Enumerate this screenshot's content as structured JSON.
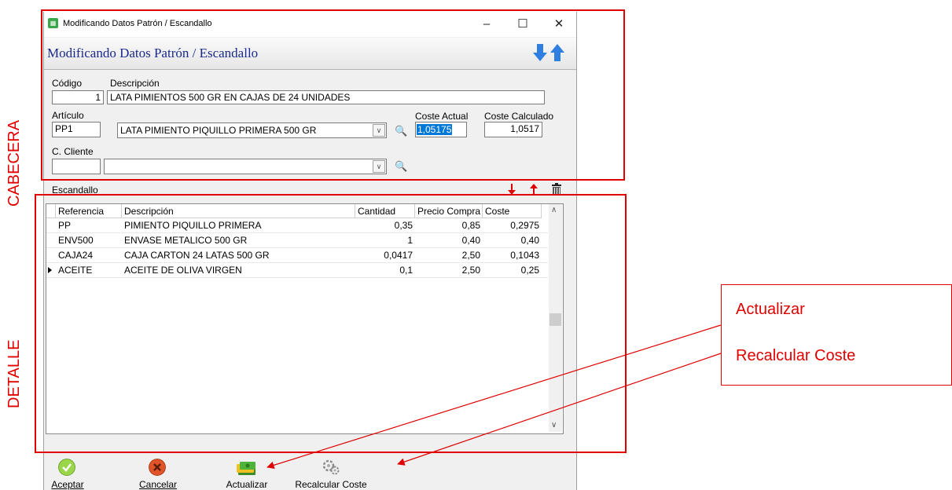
{
  "window": {
    "title": "Modificando Datos Patrón / Escandallo",
    "heading": "Modificando Datos Patrón / Escandallo"
  },
  "form": {
    "codigo_label": "Código",
    "codigo_value": "1",
    "descripcion_label": "Descripción",
    "descripcion_value": "LATA PIMIENTOS 500 GR EN CAJAS DE 24 UNIDADES",
    "articulo_label": "Artículo",
    "articulo_code": "PP1",
    "articulo_desc": "LATA PIMIENTO PIQUILLO PRIMERA 500 GR",
    "coste_actual_label": "Coste Actual",
    "coste_actual_value": "1,05175",
    "coste_calculado_label": "Coste Calculado",
    "coste_calculado_value": "1,0517",
    "cliente_label": "C. Cliente",
    "cliente_code": "",
    "cliente_desc": ""
  },
  "grid": {
    "section_label": "Escandallo",
    "columns": [
      "Referencia",
      "Descripción",
      "Cantidad",
      "Precio Compra",
      "Coste"
    ],
    "rows": [
      {
        "ref": "PP",
        "desc": "PIMIENTO PIQUILLO PRIMERA",
        "cantidad": "0,35",
        "precio": "0,85",
        "coste": "0,2975"
      },
      {
        "ref": "ENV500",
        "desc": "ENVASE METALICO 500 GR",
        "cantidad": "1",
        "precio": "0,40",
        "coste": "0,40"
      },
      {
        "ref": "CAJA24",
        "desc": "CAJA CARTON 24 LATAS 500 GR",
        "cantidad": "0,0417",
        "precio": "2,50",
        "coste": "0,1043"
      },
      {
        "ref": "ACEITE",
        "desc": "ACEITE DE OLIVA VIRGEN",
        "cantidad": "0,1",
        "precio": "2,50",
        "coste": "0,25"
      }
    ]
  },
  "toolbar": {
    "aceptar": "Aceptar",
    "cancelar": "Cancelar",
    "actualizar": "Actualizar",
    "recalcular": "Recalcular Coste"
  },
  "annotations": {
    "cabecera": "CABECERA",
    "detalle": "DETALLE",
    "actualizar": "Actualizar",
    "recalcular": "Recalcular Coste"
  },
  "colors": {
    "annotation_red": "#e00000",
    "heading_blue": "#1a2a8c",
    "selection_blue": "#0078d7"
  }
}
